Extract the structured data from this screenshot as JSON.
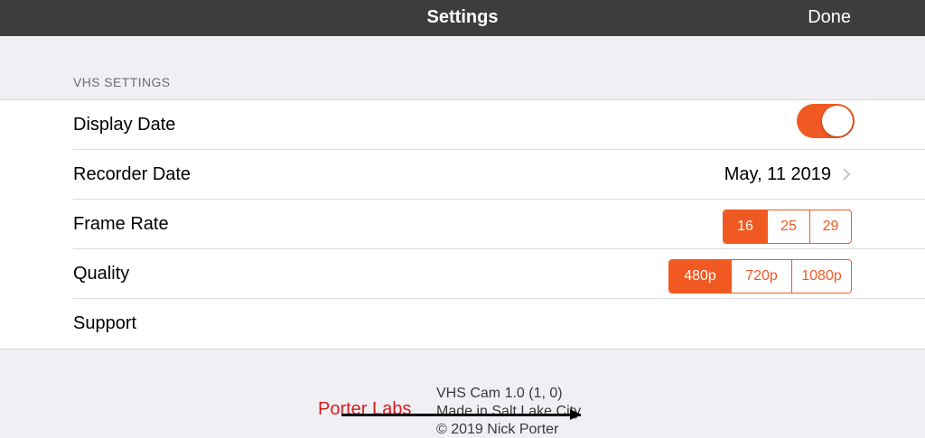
{
  "navbar": {
    "title": "Settings",
    "done_label": "Done"
  },
  "section": {
    "header": "VHS SETTINGS"
  },
  "rows": {
    "display_date": {
      "label": "Display Date",
      "enabled": true
    },
    "recorder_date": {
      "label": "Recorder Date",
      "value": "May, 11 2019"
    },
    "frame_rate": {
      "label": "Frame Rate",
      "options": [
        "16",
        "25",
        "29"
      ],
      "selected": "16"
    },
    "quality": {
      "label": "Quality",
      "options": [
        "480p",
        "720p",
        "1080p"
      ],
      "selected": "480p"
    },
    "support": {
      "label": "Support"
    }
  },
  "footer": {
    "version": "VHS Cam 1.0 (1, 0)",
    "made_in": "Made in Salt Lake City",
    "copyright": "© 2019 Nick Porter",
    "logo_text": "Porter Labs"
  },
  "colors": {
    "accent": "#f05a22",
    "navbar": "#3d3d3d",
    "background": "#efeff4"
  }
}
